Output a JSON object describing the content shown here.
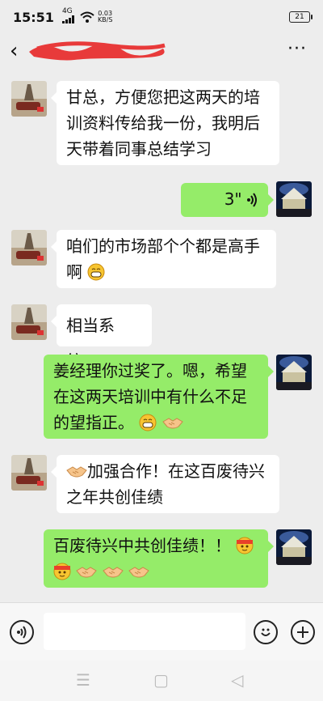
{
  "status": {
    "time": "15:51",
    "signal": "4G",
    "speed": "0.03",
    "speed_unit": "KB/S",
    "battery": "21"
  },
  "header": {
    "back_icon": "‹",
    "more_icon": "···"
  },
  "messages": [
    {
      "side": "left",
      "lines": [
        "甘总，方便您把这两天的培",
        "训资料传给我一份，我明后",
        "天带着同事总结学习"
      ]
    },
    {
      "side": "right",
      "type": "voice",
      "duration": "3\""
    },
    {
      "side": "left",
      "lines": [
        "咱们的市场部个个都是高手",
        "啊"
      ],
      "trail_emoji": "grin"
    },
    {
      "side": "left",
      "lines": [
        "相当系统，"
      ]
    },
    {
      "side": "right",
      "lines": [
        "姜经理你过奖了。嗯，希望",
        "在这两天培训中有什么不足",
        "的望指正。"
      ],
      "trail_emoji": "grin,handshake"
    },
    {
      "side": "left",
      "lines": [
        "加强合作！在这百废待兴",
        "之年共创佳绩"
      ],
      "lead_emoji": "handshake"
    },
    {
      "side": "right",
      "lines": [
        "百废待兴中共创佳绩！！"
      ],
      "trail_emoji": "ninja,ninja,handshake,handshake,handshake"
    }
  ],
  "input": {
    "placeholder": ""
  },
  "icons": {
    "voice": "voice-icon",
    "emoji": "emoji-icon",
    "add": "add-icon"
  },
  "nav": {
    "menu": "☰",
    "home": "▢",
    "back": "◁"
  },
  "colors": {
    "sent": "#95ec69",
    "received": "#ffffff",
    "bg": "#ededed"
  }
}
